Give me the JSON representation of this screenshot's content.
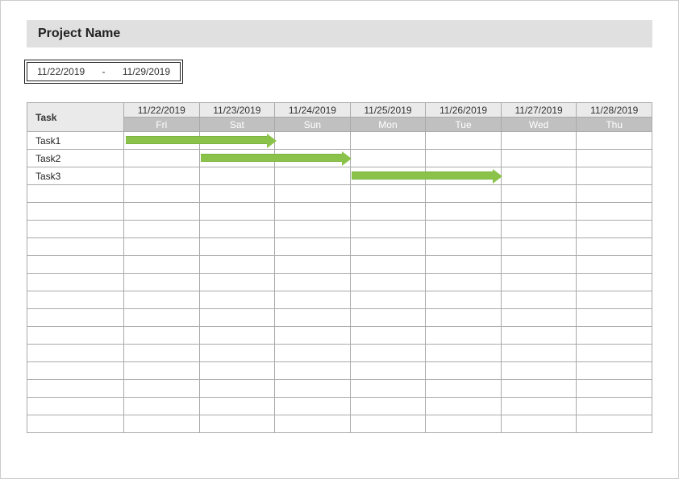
{
  "title": "Project Name",
  "date_range": {
    "start": "11/22/2019",
    "end": "11/29/2019",
    "separator": "-"
  },
  "gantt": {
    "task_header": "Task",
    "columns": [
      {
        "date": "11/22/2019",
        "day": "Fri"
      },
      {
        "date": "11/23/2019",
        "day": "Sat"
      },
      {
        "date": "11/24/2019",
        "day": "Sun"
      },
      {
        "date": "11/25/2019",
        "day": "Mon"
      },
      {
        "date": "11/26/2019",
        "day": "Tue"
      },
      {
        "date": "11/27/2019",
        "day": "Wed"
      },
      {
        "date": "11/28/2019",
        "day": "Thu"
      }
    ],
    "tasks": [
      {
        "name": "Task1",
        "start_col": 0,
        "end_col": 2
      },
      {
        "name": "Task2",
        "start_col": 1,
        "end_col": 3
      },
      {
        "name": "Task3",
        "start_col": 3,
        "end_col": 5
      }
    ],
    "empty_rows": 14
  },
  "chart_data": {
    "type": "gantt",
    "title": "Project Name",
    "x_range": [
      "11/22/2019",
      "11/28/2019"
    ],
    "categories": [
      "11/22/2019",
      "11/23/2019",
      "11/24/2019",
      "11/25/2019",
      "11/26/2019",
      "11/27/2019",
      "11/28/2019"
    ],
    "day_labels": [
      "Fri",
      "Sat",
      "Sun",
      "Mon",
      "Tue",
      "Wed",
      "Thu"
    ],
    "series": [
      {
        "name": "Task1",
        "start": "11/22/2019",
        "end": "11/24/2019"
      },
      {
        "name": "Task2",
        "start": "11/23/2019",
        "end": "11/25/2019"
      },
      {
        "name": "Task3",
        "start": "11/25/2019",
        "end": "11/27/2019"
      }
    ],
    "color": "#8bc34a"
  }
}
